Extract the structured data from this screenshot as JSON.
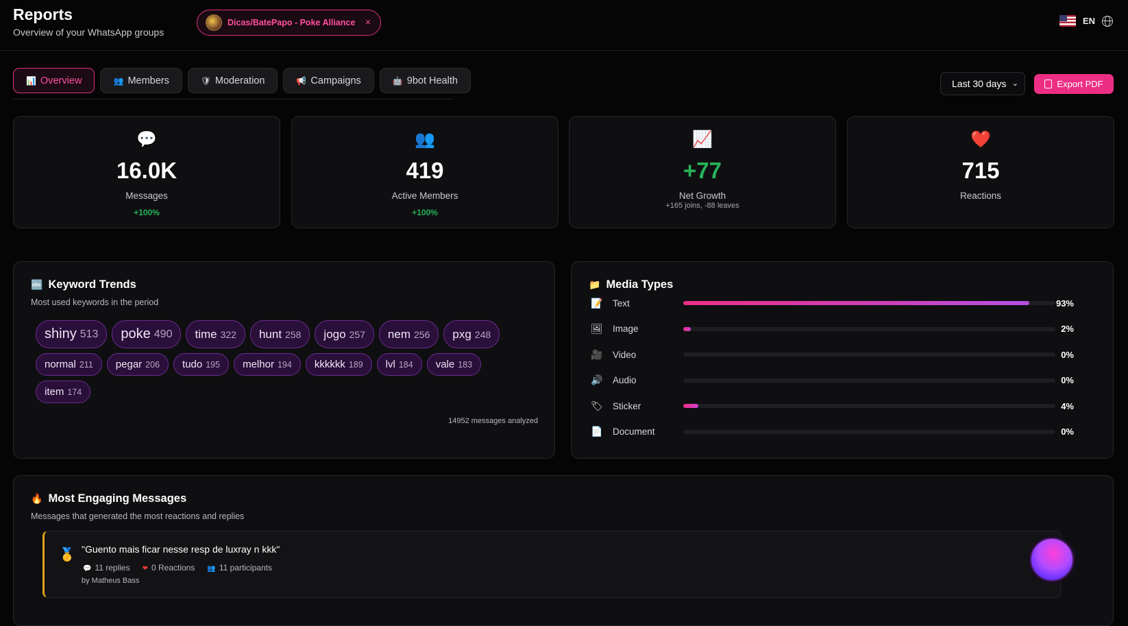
{
  "header": {
    "title": "Reports",
    "subtitle": "Overview of your WhatsApp groups",
    "group_chip": {
      "name": "Dicas/BatePapo - Poke Alliance",
      "close": "×"
    },
    "language": "EN"
  },
  "tabs": [
    {
      "icon": "📊",
      "label": "Overview",
      "active": true
    },
    {
      "icon": "👥",
      "label": "Members"
    },
    {
      "icon": "🛡",
      "label": "Moderation"
    },
    {
      "icon": "📢",
      "label": "Campaigns"
    },
    {
      "icon": "🤖",
      "label": "9bot Health"
    }
  ],
  "controls": {
    "range": "Last 30 days",
    "export_label": "Export PDF"
  },
  "stats": [
    {
      "icon": "💬",
      "value": "16.0K",
      "label": "Messages",
      "change": "+100%"
    },
    {
      "icon": "👥",
      "value": "419",
      "label": "Active Members",
      "change": "+100%"
    },
    {
      "icon": "📈",
      "value": "+77",
      "label": "Net Growth",
      "change": "+165 joins, -88 leaves"
    },
    {
      "icon": "❤️",
      "value": "715",
      "label": "Reactions",
      "change": ""
    }
  ],
  "keywords": {
    "icon": "🔤",
    "title": "Keyword Trends",
    "subtitle": "Most used keywords in the period",
    "items": [
      {
        "word": "shiny",
        "count": "513"
      },
      {
        "word": "poke",
        "count": "490"
      },
      {
        "word": "time",
        "count": "322"
      },
      {
        "word": "hunt",
        "count": "258"
      },
      {
        "word": "jogo",
        "count": "257"
      },
      {
        "word": "nem",
        "count": "256"
      },
      {
        "word": "pxg",
        "count": "248"
      },
      {
        "word": "normal",
        "count": "211"
      },
      {
        "word": "pegar",
        "count": "206"
      },
      {
        "word": "tudo",
        "count": "195"
      },
      {
        "word": "melhor",
        "count": "194"
      },
      {
        "word": "kkkkkk",
        "count": "189"
      },
      {
        "word": "lvl",
        "count": "184"
      },
      {
        "word": "vale",
        "count": "183"
      },
      {
        "word": "item",
        "count": "174"
      }
    ],
    "footer": "14952 messages analyzed"
  },
  "media": {
    "icon": "📁",
    "title": "Media Types",
    "items": [
      {
        "icon": "📝",
        "label": "Text",
        "pct": "93%",
        "value": 93
      },
      {
        "icon": "🖼",
        "label": "Image",
        "pct": "2%",
        "value": 2
      },
      {
        "icon": "🎥",
        "label": "Video",
        "pct": "0%",
        "value": 0
      },
      {
        "icon": "🔊",
        "label": "Audio",
        "pct": "0%",
        "value": 0
      },
      {
        "icon": "🏷",
        "label": "Sticker",
        "pct": "4%",
        "value": 4
      },
      {
        "icon": "📄",
        "label": "Document",
        "pct": "0%",
        "value": 0
      }
    ]
  },
  "engaging": {
    "icon": "🔥",
    "title": "Most Engaging Messages",
    "subtitle": "Messages that generated the most reactions and replies",
    "items": [
      {
        "medal": "🥇",
        "quote": "\"Guento mais ficar nesse resp de luxray n kkk\"",
        "replies": "11 replies",
        "reactions": "0 Reactions",
        "participants": "11 participants",
        "author": "by Matheus Bass"
      }
    ]
  }
}
